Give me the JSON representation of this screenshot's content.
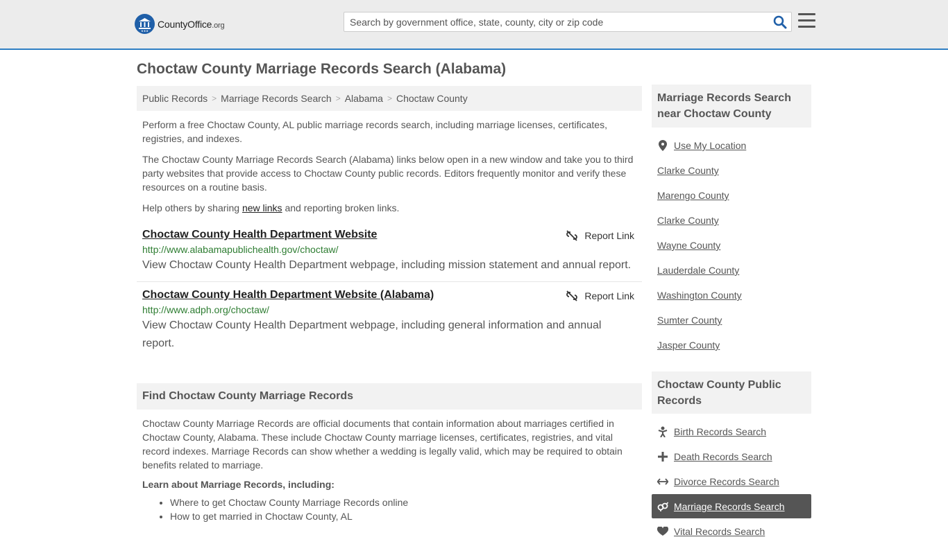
{
  "header": {
    "logo_main": "CountyOffice",
    "logo_tld": ".org",
    "search_placeholder": "Search by government office, state, county, city or zip code"
  },
  "page_title": "Choctaw County Marriage Records Search (Alabama)",
  "breadcrumb": [
    "Public Records",
    "Marriage Records Search",
    "Alabama",
    "Choctaw County"
  ],
  "intro": {
    "p1": "Perform a free Choctaw County, AL public marriage records search, including marriage licenses, certificates, registries, and indexes.",
    "p2": "The Choctaw County Marriage Records Search (Alabama) links below open in a new window and take you to third party websites that provide access to Choctaw County public records. Editors frequently monitor and verify these resources on a routine basis.",
    "p3_before": "Help others by sharing ",
    "p3_link": "new links",
    "p3_after": " and reporting broken links."
  },
  "links": [
    {
      "title": "Choctaw County Health Department Website",
      "url": "http://www.alabamapublichealth.gov/choctaw/",
      "desc": "View Choctaw County Health Department webpage, including mission statement and annual report.",
      "report": "Report Link"
    },
    {
      "title": "Choctaw County Health Department Website (Alabama)",
      "url": "http://www.adph.org/choctaw/",
      "desc": "View Choctaw County Health Department webpage, including general information and annual report.",
      "report": "Report Link"
    }
  ],
  "find_section": {
    "heading": "Find Choctaw County Marriage Records",
    "body": "Choctaw County Marriage Records are official documents that contain information about marriages certified in Choctaw County, Alabama. These include Choctaw County marriage licenses, certificates, registries, and vital record indexes. Marriage Records can show whether a wedding is legally valid, which may be required to obtain benefits related to marriage.",
    "learn_heading": "Learn about Marriage Records, including:",
    "bullets": [
      "Where to get Choctaw County Marriage Records online",
      "How to get married in Choctaw County, AL"
    ]
  },
  "sidebar": {
    "nearby_heading": "Marriage Records Search near Choctaw County",
    "use_location": "Use My Location",
    "nearby": [
      "Clarke County",
      "Marengo County",
      "Clarke County",
      "Wayne County",
      "Lauderdale County",
      "Washington County",
      "Sumter County",
      "Jasper County"
    ],
    "public_heading": "Choctaw County Public Records",
    "public": [
      {
        "label": "Birth Records Search",
        "icon": "baby-icon"
      },
      {
        "label": "Death Records Search",
        "icon": "cross-icon"
      },
      {
        "label": "Divorce Records Search",
        "icon": "arrows-icon"
      },
      {
        "label": "Marriage Records Search",
        "icon": "marriage-icon"
      },
      {
        "label": "Vital Records Search",
        "icon": "heartbeat-icon"
      }
    ]
  }
}
